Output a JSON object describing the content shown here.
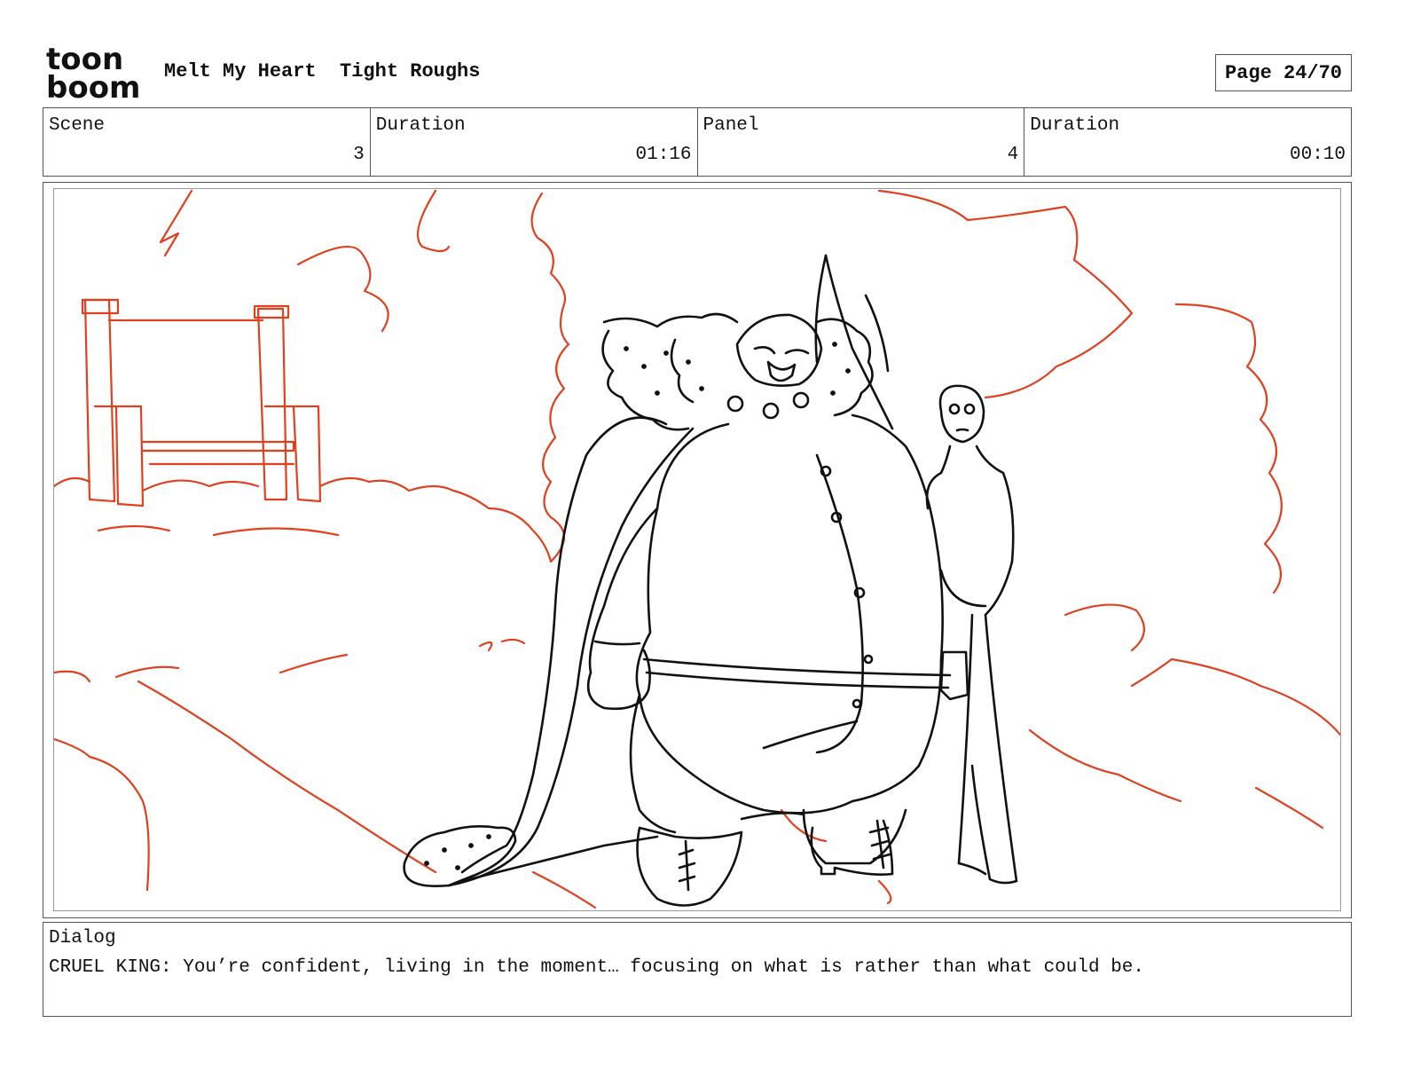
{
  "header": {
    "logo_line1": "toon",
    "logo_line2": "boom",
    "project_title": "Melt My Heart  Tight Roughs",
    "page": "Page 24/70"
  },
  "info": {
    "scene_label": "Scene",
    "scene_value": "3",
    "scene_duration_label": "Duration",
    "scene_duration_value": "01:16",
    "panel_label": "Panel",
    "panel_value": "4",
    "panel_duration_label": "Duration",
    "panel_duration_value": "00:10"
  },
  "dialog": {
    "label": "Dialog",
    "text": "CRUEL KING: You’re confident, living in the moment… focusing on what is rather than what could be."
  },
  "colors": {
    "rough_line": "#e0401e",
    "ink_line": "#111111",
    "border": "#555555"
  }
}
